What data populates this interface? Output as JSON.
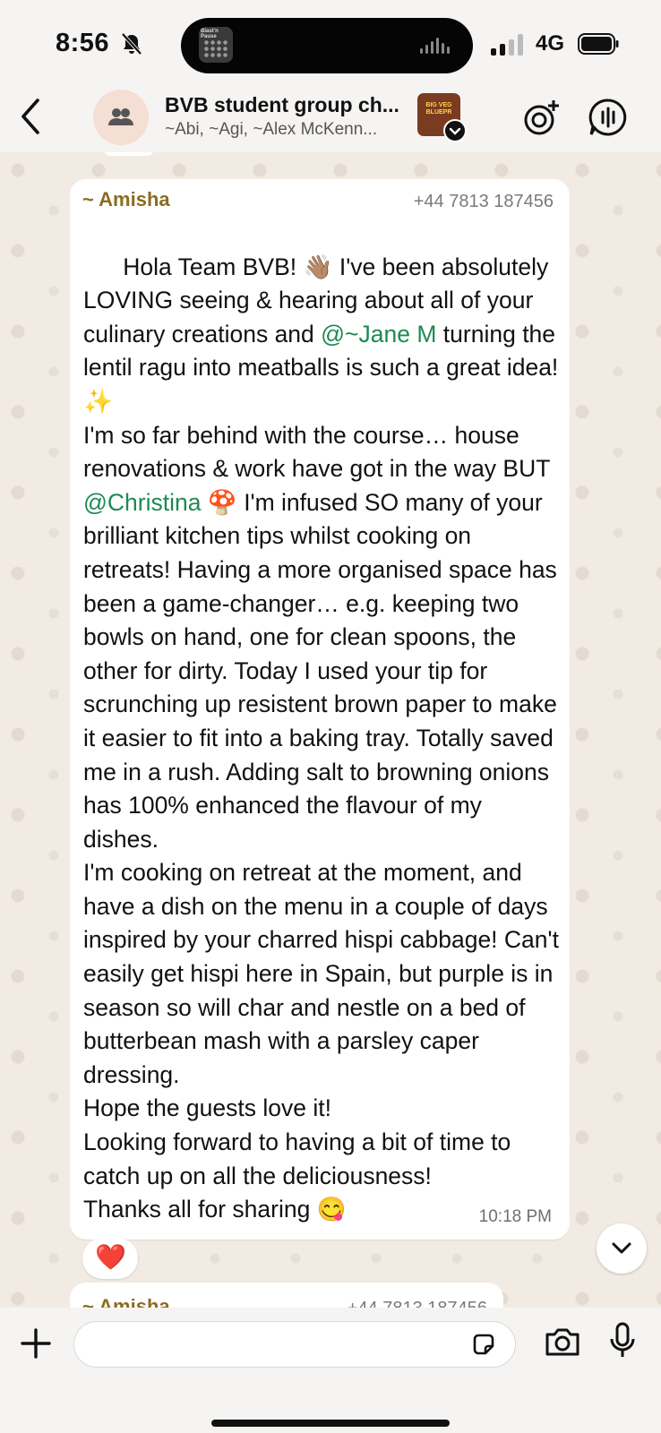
{
  "status_bar": {
    "time": "8:56",
    "network": "4G",
    "island_thumb_label": "Blast'n Pause"
  },
  "header": {
    "title": "BVB student group ch...",
    "subtitle": "~Abi, ~Agi, ~Alex McKenn...",
    "badge_text": "BIG VEG BLUEPR"
  },
  "message": {
    "sender": "~ Amisha",
    "phone": "+44 7813 187456",
    "segments": [
      {
        "text": "Hola Team BVB! 👋🏽 I've been absolutely LOVING seeing & hearing about all of your culinary creations and "
      },
      {
        "text": "@~Jane M",
        "mention": true
      },
      {
        "text": " turning the lentil ragu into meatballs is such a great idea! ✨\nI'm so far behind with the course… house renovations & work have got in the way BUT "
      },
      {
        "text": "@Christina",
        "mention": true
      },
      {
        "text": " 🍄 I'm infused SO many of your brilliant kitchen tips whilst cooking on retreats! Having a more organised space has been a game-changer… e.g. keeping two bowls on hand, one for clean spoons, the other for dirty. Today I used your tip for scrunching up resistent brown paper to make it easier to fit into a baking tray. Totally saved me in a rush. Adding salt to browning onions has 100% enhanced the flavour of my dishes.\nI'm cooking on retreat at the moment, and have a dish on the menu in a couple of days inspired by your charred hispi cabbage! Can't easily get hispi here in Spain, but purple is in season so will char and nestle on a bed of butterbean mash with a parsley caper dressing.\nHope the guests love it!\nLooking forward to having a bit of time to catch up on all the deliciousness!\nThanks all for sharing 😋"
      }
    ],
    "time": "10:18 PM",
    "reaction": "❤️"
  },
  "next_message": {
    "sender": "~ Amisha",
    "phone": "+44 7813 187456"
  },
  "input": {
    "placeholder": ""
  },
  "colors": {
    "sender": "#8a6d1f",
    "mention": "#1d8a52",
    "chat_bg": "#f1ebe3"
  },
  "icons": [
    "bell-slash-icon",
    "signal-icon",
    "battery-icon",
    "back-icon",
    "group-icon",
    "add-status-icon",
    "voice-chat-icon",
    "chevron-down-icon",
    "plus-icon",
    "sticker-icon",
    "camera-icon",
    "mic-icon"
  ]
}
